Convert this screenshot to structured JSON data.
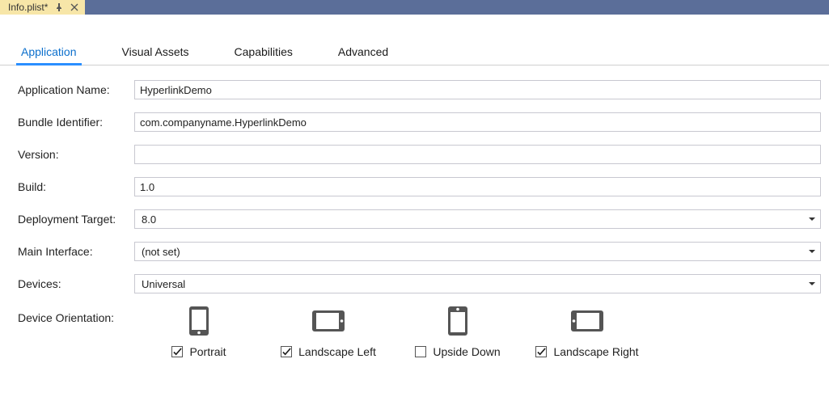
{
  "docTab": {
    "title": "Info.plist*"
  },
  "tabs": [
    {
      "label": "Application",
      "active": true
    },
    {
      "label": "Visual Assets",
      "active": false
    },
    {
      "label": "Capabilities",
      "active": false
    },
    {
      "label": "Advanced",
      "active": false
    }
  ],
  "fields": {
    "appName": {
      "label": "Application Name:",
      "value": "HyperlinkDemo"
    },
    "bundleId": {
      "label": "Bundle Identifier:",
      "value": "com.companyname.HyperlinkDemo"
    },
    "version": {
      "label": "Version:",
      "value": ""
    },
    "build": {
      "label": "Build:",
      "value": "1.0"
    },
    "deployTarget": {
      "label": "Deployment Target:",
      "value": "8.0"
    },
    "mainInterface": {
      "label": "Main Interface:",
      "value": "(not set)"
    },
    "devices": {
      "label": "Devices:",
      "value": "Universal"
    },
    "orientation": {
      "label": "Device Orientation:"
    }
  },
  "orientations": [
    {
      "label": "Portrait",
      "checked": true,
      "icon": "portrait"
    },
    {
      "label": "Landscape Left",
      "checked": true,
      "icon": "landscape"
    },
    {
      "label": "Upside Down",
      "checked": false,
      "icon": "portrait"
    },
    {
      "label": "Landscape Right",
      "checked": true,
      "icon": "landscape"
    }
  ]
}
